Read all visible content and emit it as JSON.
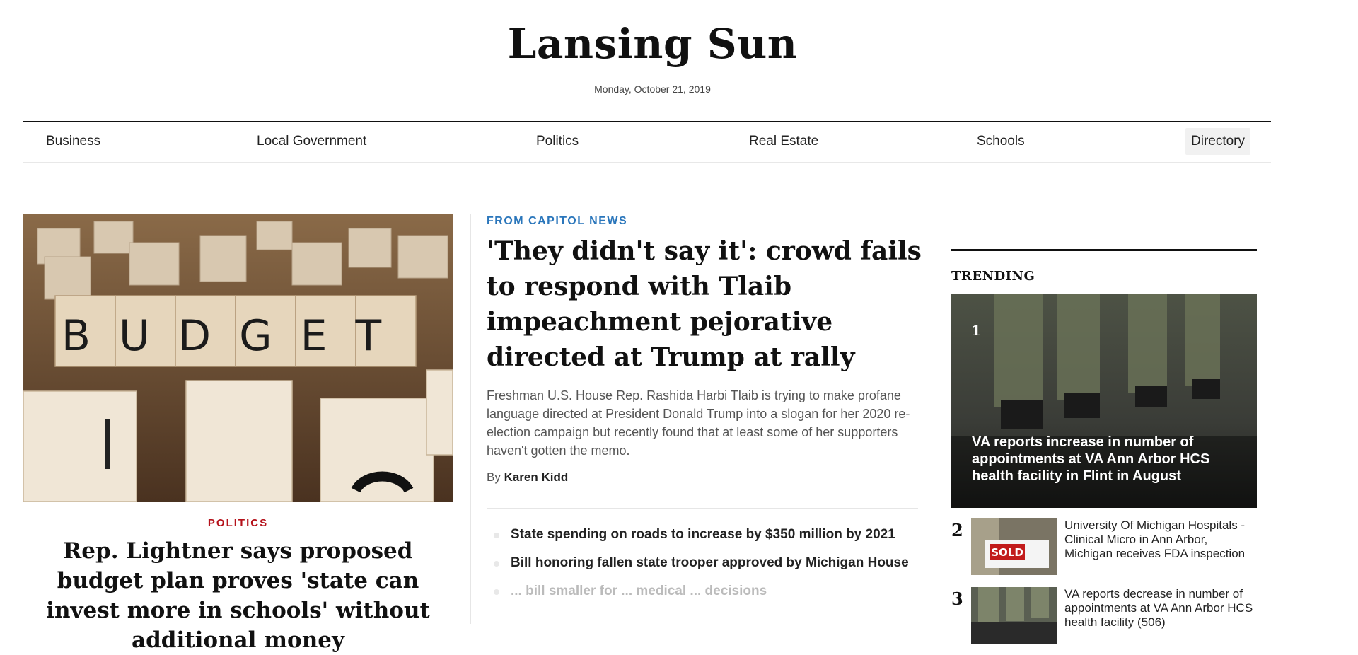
{
  "header": {
    "site_title": "Lansing Sun",
    "date": "Monday, October 21, 2019"
  },
  "nav": {
    "items": [
      "Business",
      "Local Government",
      "Politics",
      "Real Estate",
      "Schools",
      "Directory"
    ]
  },
  "lead_story": {
    "image_text": "BUDGET",
    "category": "POLITICS",
    "headline": "Rep. Lightner says proposed budget plan proves 'state can invest more in schools' without additional money"
  },
  "main_story": {
    "kicker": "FROM CAPITOL NEWS",
    "headline": "'They didn't say it': crowd fails to respond with Tlaib impeachment pejorative directed at Trump at rally",
    "summary": "Freshman U.S. House Rep. Rashida Harbi Tlaib is trying to make profane language directed at President Donald Trump into a slogan for her 2020 re-election campaign but recently found that at least some of her supporters haven't gotten the memo.",
    "byline_prefix": "By",
    "author": "Karen Kidd",
    "related": [
      "State spending on roads to increase by $350 million by 2021",
      "Bill honoring fallen state trooper approved by Michigan House",
      "... bill smaller for ... medical ... decisions"
    ]
  },
  "trending": {
    "title": "TRENDING",
    "feature": {
      "number": "1",
      "headline": "VA reports increase in number of appointments at VA Ann Arbor HCS health facility in Flint in August"
    },
    "items": [
      {
        "number": "2",
        "thumb_text": "SOLD",
        "headline": "University Of Michigan Hospitals - Clinical Micro in Ann Arbor, Michigan receives FDA inspection"
      },
      {
        "number": "3",
        "thumb_text": "",
        "headline": "VA reports decrease in number of appointments at VA Ann Arbor HCS health facility (506)"
      }
    ]
  },
  "colors": {
    "kicker_red": "#b5121b",
    "kicker_blue": "#2a76bb",
    "rule": "#111111"
  }
}
